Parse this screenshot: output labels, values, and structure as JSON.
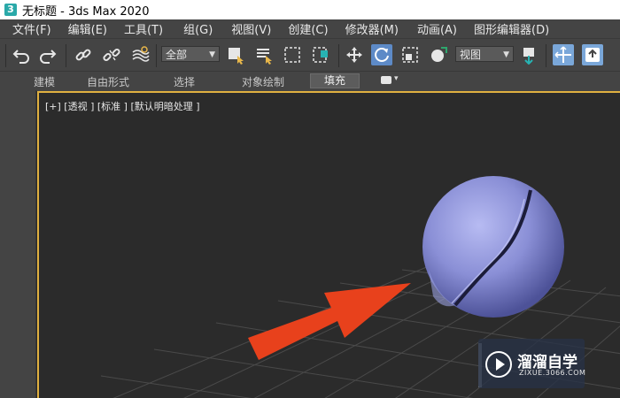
{
  "window": {
    "title": "无标题 - 3ds Max 2020",
    "app_icon_glyph": "3"
  },
  "menu": {
    "items": [
      {
        "label": "文件(F)"
      },
      {
        "label": "编辑(E)"
      },
      {
        "label": "工具(T)"
      },
      {
        "label": "组(G)"
      },
      {
        "label": "视图(V)"
      },
      {
        "label": "创建(C)"
      },
      {
        "label": "修改器(M)"
      },
      {
        "label": "动画(A)"
      },
      {
        "label": "图形编辑器(D)"
      }
    ]
  },
  "toolbar": {
    "selection_filter": "全部",
    "reference_coord": "视图",
    "icons": [
      "undo-icon",
      "redo-icon",
      "link-icon",
      "unlink-icon",
      "bind-space-warp-icon",
      "select-object-icon",
      "select-by-name-icon",
      "rect-select-region-icon",
      "window-crossing-icon",
      "move-icon",
      "rotate-icon",
      "scale-icon",
      "placement-icon",
      "pivot-icon",
      "snap-icon",
      "selection-lock-icon"
    ]
  },
  "ribbon": {
    "tabs": [
      {
        "label": "建模"
      },
      {
        "label": "自由形式"
      },
      {
        "label": "选择"
      },
      {
        "label": "对象绘制"
      }
    ],
    "active_tab": "填充"
  },
  "viewport": {
    "label": "[+] [透视 ] [标准 ] [默认明暗处理 ]",
    "border_color": "#e0b040",
    "sphere_color": "#8a8fd6",
    "arrow_color": "#e8411c"
  },
  "watermark": {
    "title": "溜溜自学",
    "subtitle": "ZIXUE.3066.COM"
  }
}
